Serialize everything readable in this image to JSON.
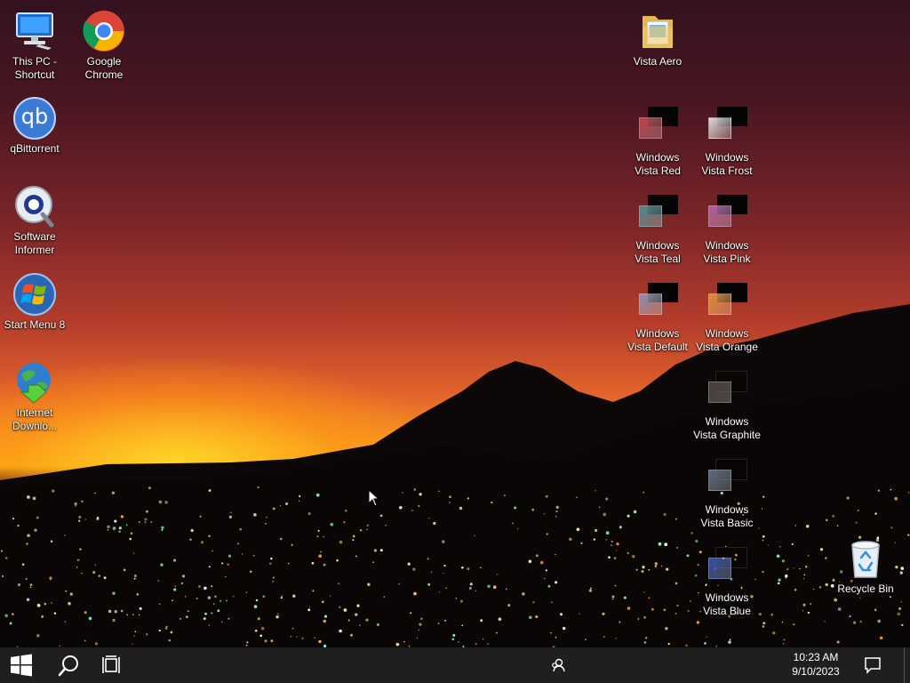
{
  "desktop": {
    "icons": {
      "this_pc": {
        "label": "This PC - Shortcut",
        "icon": "monitor-icon"
      },
      "chrome": {
        "label": "Google Chrome",
        "icon": "chrome-icon"
      },
      "qbittorrent": {
        "label": "qBittorrent",
        "icon": "qbittorrent-icon",
        "glyph_text": "qb"
      },
      "software_informer": {
        "label": "Software Informer",
        "icon": "magnifier-icon"
      },
      "start_menu8": {
        "label": "Start Menu 8",
        "icon": "windows-orb-icon"
      },
      "idm": {
        "label": "Internet Downlo...",
        "icon": "globe-download-icon"
      },
      "vista_aero": {
        "label": "Vista Aero",
        "icon": "folder-icon"
      },
      "vista_red": {
        "label": "Windows Vista Red",
        "color": "#c0404a"
      },
      "vista_frost": {
        "label": "Windows Vista Frost",
        "color": "#d8d8d8"
      },
      "vista_teal": {
        "label": "Windows Vista Teal",
        "color": "#4a8a8a"
      },
      "vista_pink": {
        "label": "Windows Vista Pink",
        "color": "#b060a0"
      },
      "vista_default": {
        "label": "Windows Vista Default",
        "color": "#8a90a8"
      },
      "vista_orange": {
        "label": "Windows Vista Orange",
        "color": "#e08a30"
      },
      "vista_graphite": {
        "label": "Windows Vista Graphite",
        "color": "#4a3c3c"
      },
      "vista_basic": {
        "label": "Windows Vista Basic",
        "color": "#5a6a80"
      },
      "vista_blue": {
        "label": "Windows Vista Blue",
        "color": "#3050a8"
      },
      "recycle_bin": {
        "label": "Recycle Bin",
        "icon": "recycle-bin-icon"
      }
    }
  },
  "taskbar": {
    "start_icon": "windows-logo-icon",
    "search_icon": "search-icon",
    "task_view_icon": "task-view-icon",
    "people_icon": "people-icon",
    "notification_icon": "notification-icon",
    "clock": {
      "time": "10:23 AM",
      "date": "9/10/2023"
    }
  }
}
